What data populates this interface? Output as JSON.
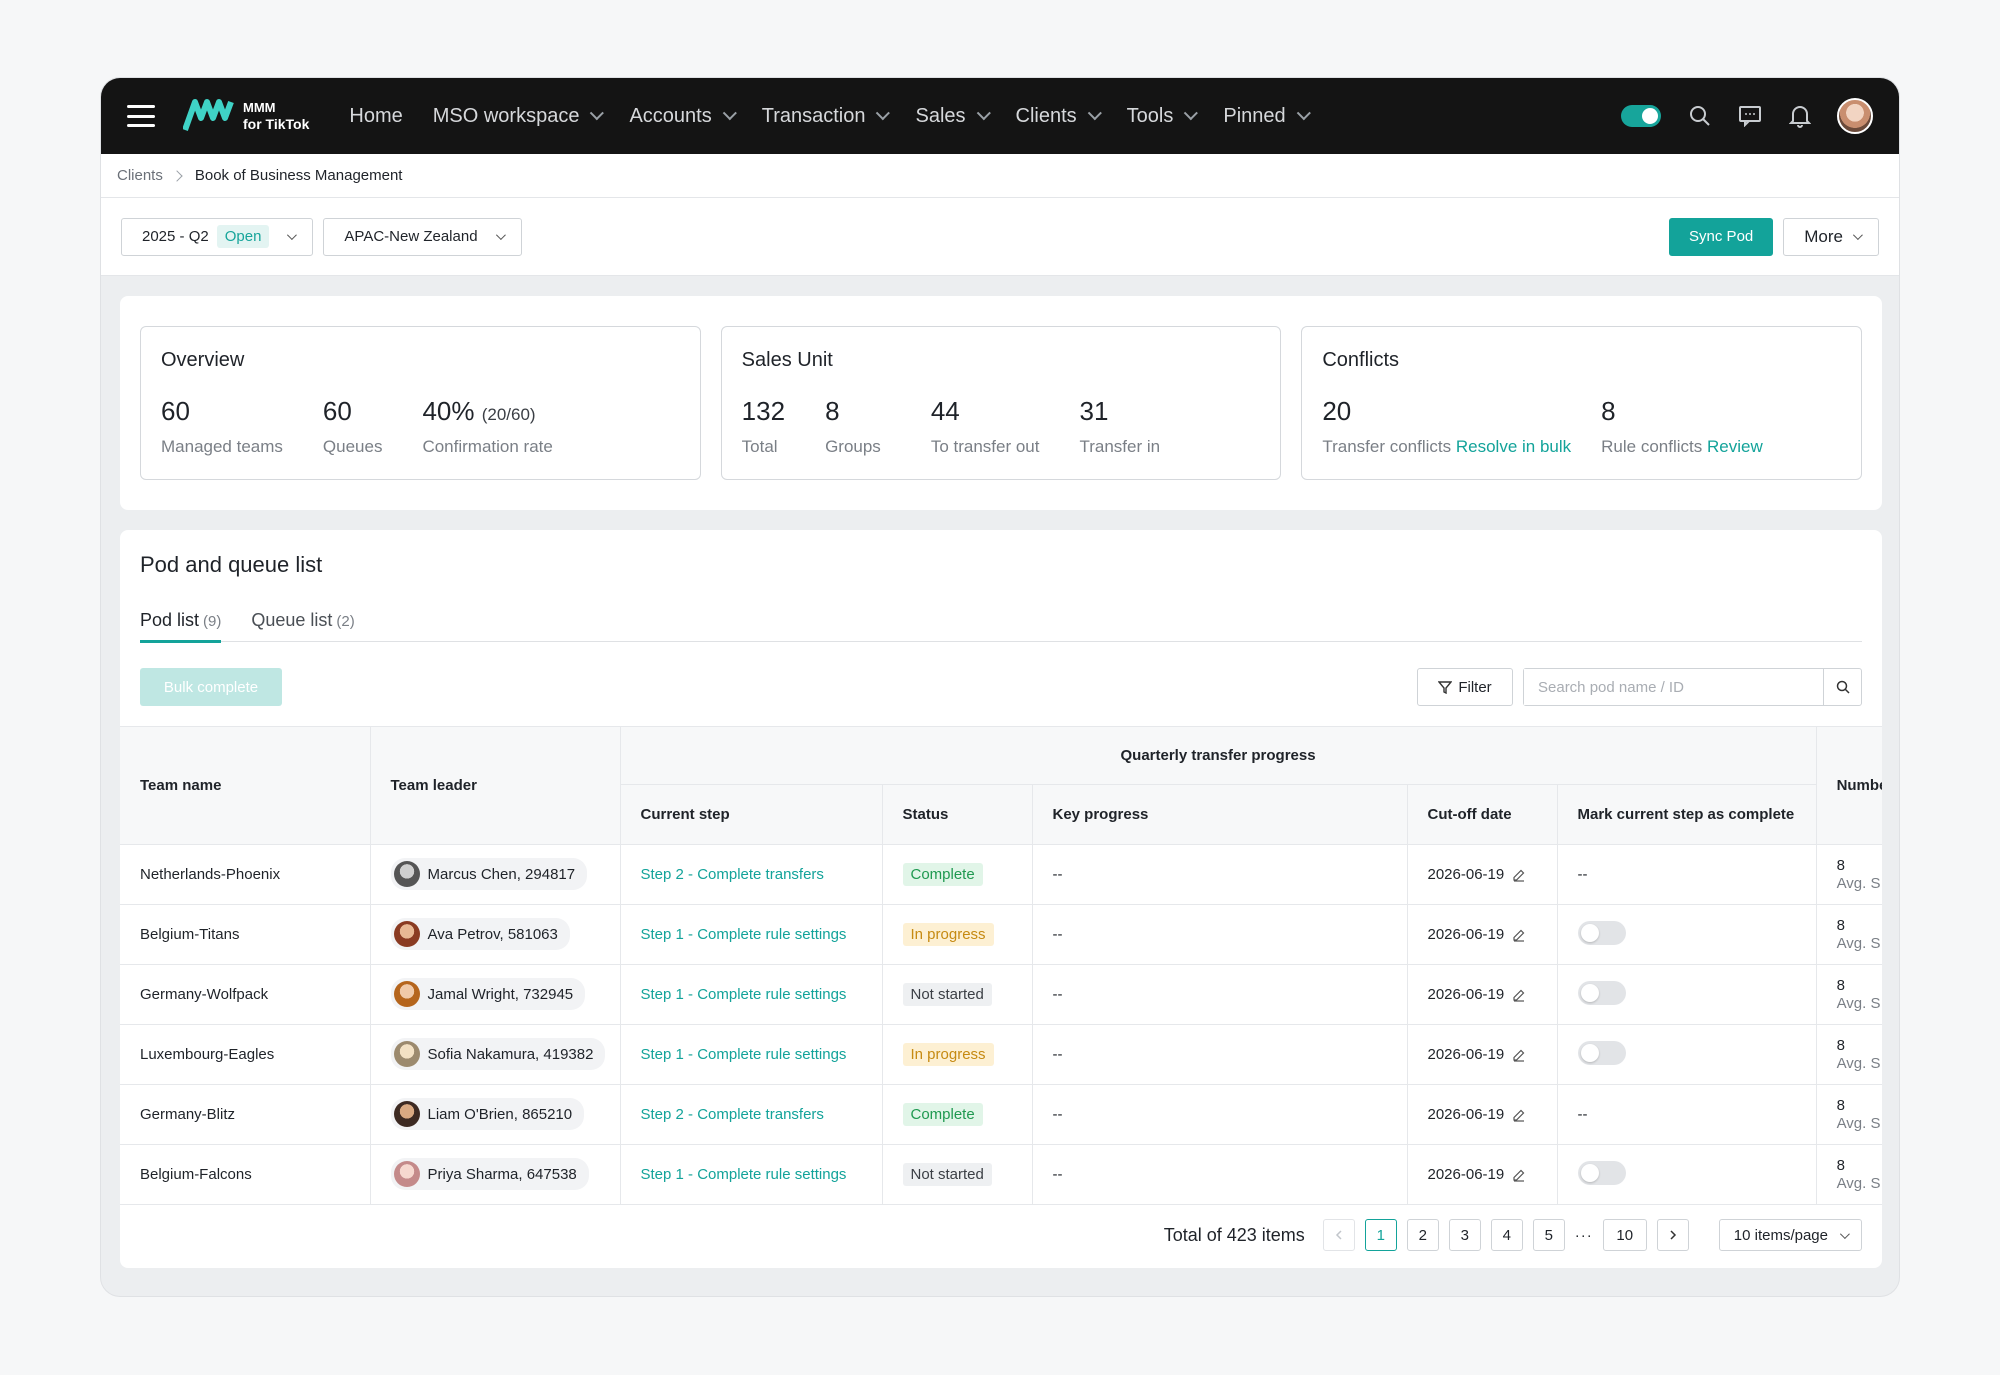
{
  "nav": {
    "logo_line1": "MMM",
    "logo_line2": "for TikTok",
    "items": [
      {
        "label": "Home",
        "has_dropdown": false
      },
      {
        "label": "MSO workspace",
        "has_dropdown": true
      },
      {
        "label": "Accounts",
        "has_dropdown": true
      },
      {
        "label": "Transaction",
        "has_dropdown": true
      },
      {
        "label": "Sales",
        "has_dropdown": true
      },
      {
        "label": "Clients",
        "has_dropdown": true
      },
      {
        "label": "Tools",
        "has_dropdown": true
      },
      {
        "label": "Pinned",
        "has_dropdown": true
      }
    ],
    "icons": [
      "toggle-switch",
      "search-icon",
      "message-icon",
      "bell-icon",
      "user-avatar"
    ]
  },
  "breadcrumb": {
    "parent": "Clients",
    "current": "Book of Business Management"
  },
  "filters": {
    "period": "2025 - Q2",
    "period_badge": "Open",
    "region": "APAC-New Zealand",
    "sync_label": "Sync Pod",
    "more_label": "More"
  },
  "overview": {
    "title": "Overview",
    "stats": [
      {
        "value": "60",
        "label": "Managed teams"
      },
      {
        "value": "60",
        "label": "Queues"
      },
      {
        "value": "40%",
        "sub": "(20/60)",
        "label": "Confirmation rate"
      }
    ]
  },
  "sales_unit": {
    "title": "Sales Unit",
    "stats": [
      {
        "value": "132",
        "label": "Total"
      },
      {
        "value": "8",
        "label": "Groups"
      },
      {
        "value": "44",
        "label": "To transfer out"
      },
      {
        "value": "31",
        "label": "Transfer in"
      }
    ]
  },
  "conflicts": {
    "title": "Conflicts",
    "stats": [
      {
        "value": "20",
        "label": "Transfer conflicts",
        "link": "Resolve in bulk"
      },
      {
        "value": "8",
        "label": "Rule conflicts",
        "link": "Review"
      }
    ]
  },
  "list": {
    "title": "Pod and queue list",
    "tabs": [
      {
        "label": "Pod list",
        "count": "(9)",
        "active": true
      },
      {
        "label": "Queue list",
        "count": "(2)",
        "active": false
      }
    ],
    "bulk_label": "Bulk complete",
    "filter_label": "Filter",
    "search_placeholder": "Search pod name / ID"
  },
  "table": {
    "group_header": "Quarterly transfer progress",
    "headers": {
      "team_name": "Team name",
      "team_leader": "Team leader",
      "current_step": "Current step",
      "status": "Status",
      "key_progress": "Key progress",
      "cutoff": "Cut-off date",
      "mark_complete": "Mark current step as complete",
      "number": "Number"
    },
    "rows": [
      {
        "team": "Netherlands-Phoenix",
        "leader": "Marcus Chen, 294817",
        "step": "Step 2 - Complete transfers",
        "status": "Complete",
        "status_type": "complete",
        "progress": "--",
        "cutoff": "2026-06-19",
        "mark": "--",
        "toggle": false,
        "num": "8",
        "num_sub": "Avg. S"
      },
      {
        "team": "Belgium-Titans",
        "leader": "Ava Petrov, 581063",
        "step": "Step 1 - Complete rule settings",
        "status": "In progress",
        "status_type": "progress",
        "progress": "--",
        "cutoff": "2026-06-19",
        "mark": "",
        "toggle": true,
        "num": "8",
        "num_sub": "Avg. S"
      },
      {
        "team": "Germany-Wolfpack",
        "leader": "Jamal Wright, 732945",
        "step": "Step 1 - Complete rule settings",
        "status": "Not started",
        "status_type": "notstarted",
        "progress": "--",
        "cutoff": "2026-06-19",
        "mark": "",
        "toggle": true,
        "num": "8",
        "num_sub": "Avg. S"
      },
      {
        "team": "Luxembourg-Eagles",
        "leader": "Sofia Nakamura, 419382",
        "step": "Step 1 - Complete rule settings",
        "status": "In progress",
        "status_type": "progress",
        "progress": "--",
        "cutoff": "2026-06-19",
        "mark": "",
        "toggle": true,
        "num": "8",
        "num_sub": "Avg. S"
      },
      {
        "team": "Germany-Blitz",
        "leader": "Liam O'Brien, 865210",
        "step": "Step 2 - Complete transfers",
        "status": "Complete",
        "status_type": "complete",
        "progress": "--",
        "cutoff": "2026-06-19",
        "mark": "--",
        "toggle": false,
        "num": "8",
        "num_sub": "Avg. S"
      },
      {
        "team": "Belgium-Falcons",
        "leader": "Priya Sharma, 647538",
        "step": "Step 1 - Complete rule settings",
        "status": "Not started",
        "status_type": "notstarted",
        "progress": "--",
        "cutoff": "2026-06-19",
        "mark": "",
        "toggle": true,
        "num": "8",
        "num_sub": "Avg. S"
      }
    ]
  },
  "pagination": {
    "total": "Total of 423 items",
    "pages": [
      "1",
      "2",
      "3",
      "4",
      "5"
    ],
    "ellipsis": "···",
    "last": "10",
    "current": "1",
    "per_page": "10 items/page"
  },
  "colors": {
    "accent": "#13a39a",
    "nav_bg": "#141414",
    "complete": "#1f9950",
    "in_progress": "#c68a12"
  }
}
